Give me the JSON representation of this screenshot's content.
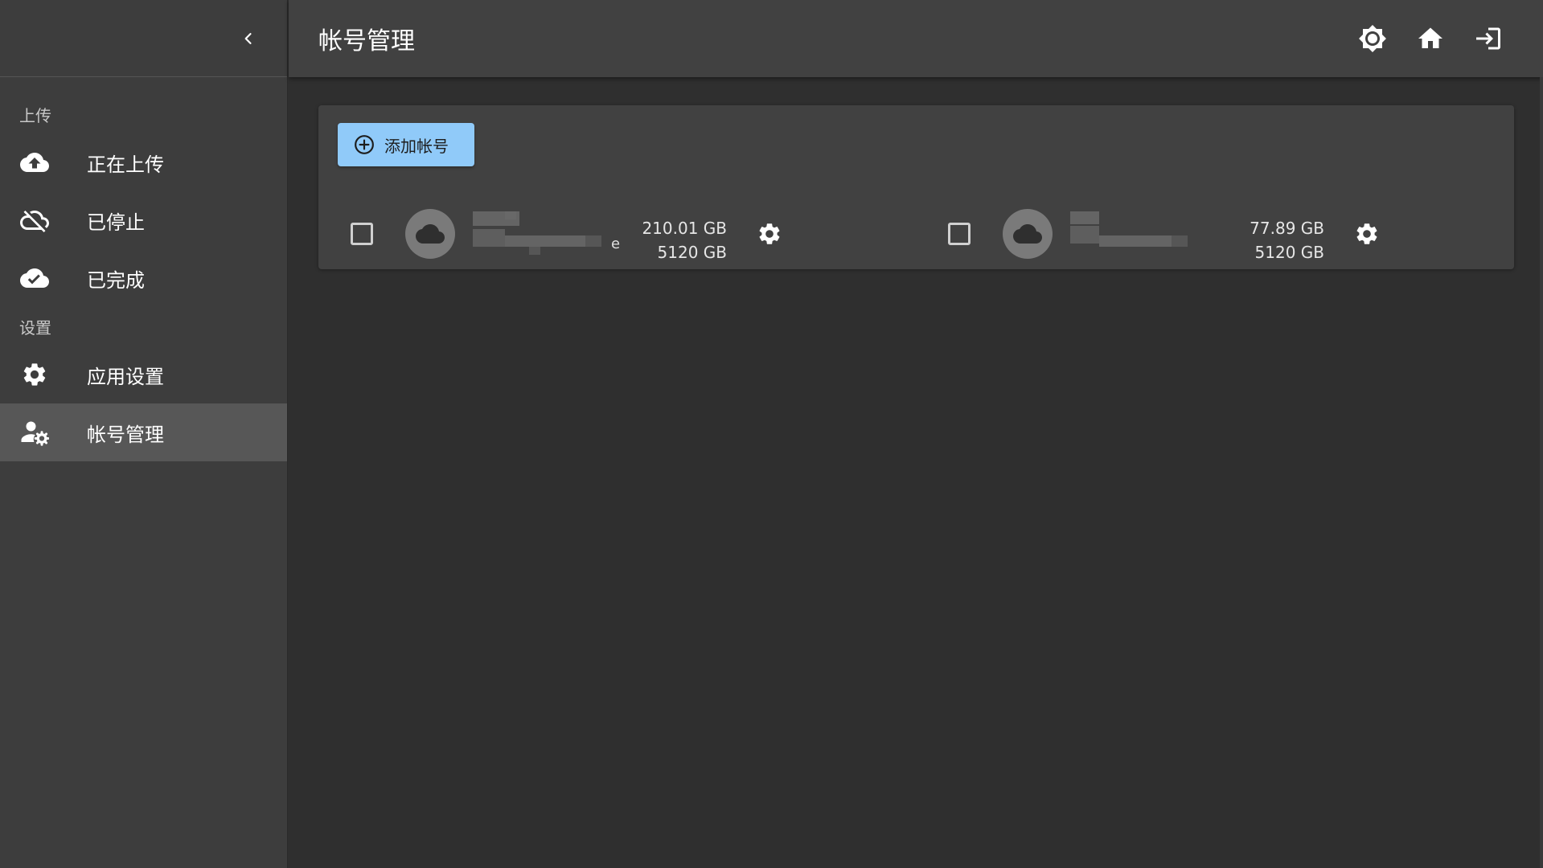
{
  "sidebar": {
    "sections": [
      {
        "label": "上传",
        "items": [
          {
            "label": "正在上传",
            "icon": "cloud-upload-icon"
          },
          {
            "label": "已停止",
            "icon": "cloud-off-icon"
          },
          {
            "label": "已完成",
            "icon": "cloud-done-icon"
          }
        ]
      },
      {
        "label": "设置",
        "items": [
          {
            "label": "应用设置",
            "icon": "gear-icon"
          },
          {
            "label": "帐号管理",
            "icon": "account-cog-icon",
            "active": true
          }
        ]
      }
    ]
  },
  "header": {
    "title": "帐号管理",
    "actions": [
      "theme-toggle-icon",
      "home-icon",
      "logout-icon"
    ]
  },
  "main": {
    "add_button_label": "添加帐号",
    "accounts": [
      {
        "name_visible_suffix": "e",
        "used": "210.01 GB",
        "total": "5120 GB"
      },
      {
        "name_visible_suffix": "",
        "used": "77.89 GB",
        "total": "5120 GB"
      }
    ]
  },
  "colors": {
    "accent": "#90caf9",
    "background": "#2f2f2f",
    "sidebar": "#3d3d3d",
    "header": "#414141",
    "active_item": "#575757"
  }
}
